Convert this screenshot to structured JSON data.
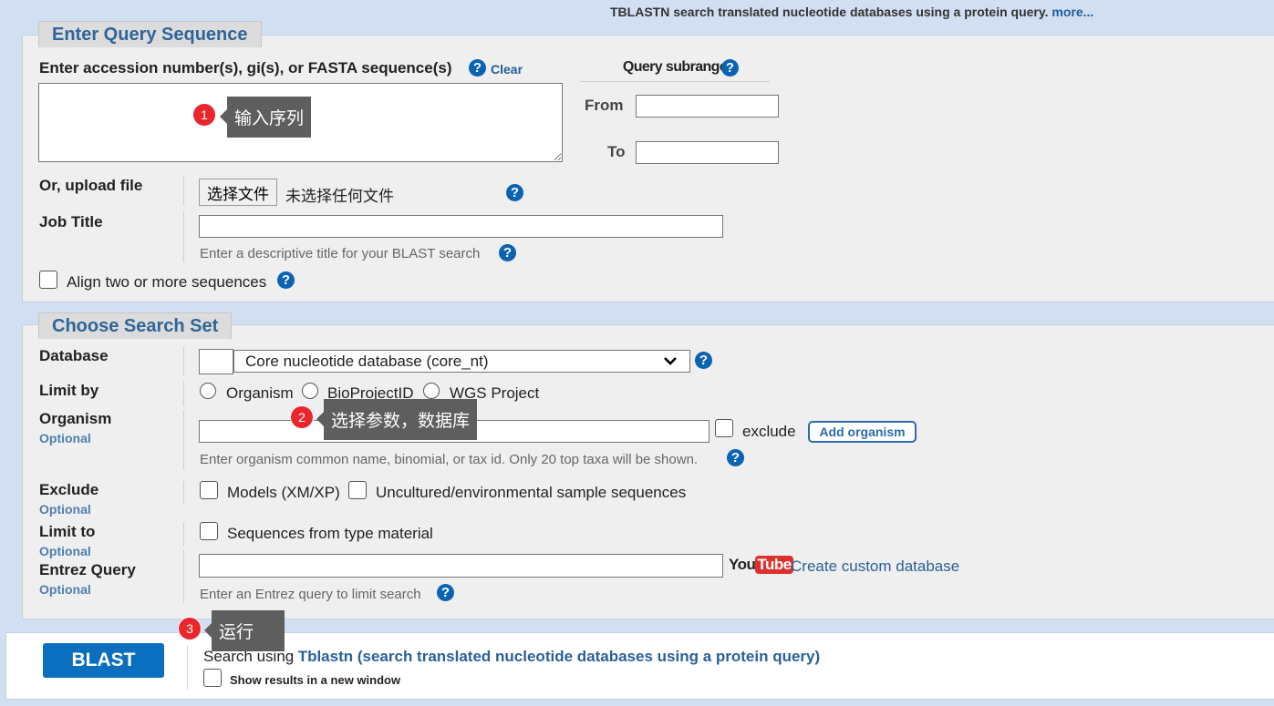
{
  "header": {
    "description": "TBLASTN search translated nucleotide databases using a protein query.",
    "more_link": "more..."
  },
  "query_section": {
    "legend": "Enter Query Sequence",
    "seq_label": "Enter accession number(s), gi(s), or FASTA sequence(s)",
    "clear_link": "Clear",
    "subrange_title": "Query subrange",
    "from_label": "From",
    "to_label": "To",
    "upload_label": "Or, upload file",
    "file_button": "选择文件",
    "file_status": "未选择任何文件",
    "job_title_label": "Job Title",
    "job_title_hint": "Enter a descriptive title for your BLAST search",
    "align_label": "Align two or more sequences"
  },
  "search_set": {
    "legend": "Choose Search Set",
    "database_label": "Database",
    "database_value": "Core nucleotide database (core_nt)",
    "limit_by_label": "Limit by",
    "limit_options": [
      "Organism",
      "BioProjectID",
      "WGS Project"
    ],
    "organism_label": "Organism",
    "optional": "Optional",
    "exclude_label": "exclude",
    "add_organism": "Add organism",
    "organism_hint": "Enter organism common name, binomial, or tax id. Only 20 top taxa will be shown.",
    "exclude_row_label": "Exclude",
    "models_label": "Models (XM/XP)",
    "uncultured_label": "Uncultured/environmental sample sequences",
    "limit_to_label": "Limit to",
    "type_material_label": "Sequences from type material",
    "entrez_label": "Entrez Query",
    "youtube_you": "You",
    "youtube_tube": "Tube",
    "custom_db_link": "Create custom database",
    "entrez_hint": "Enter an Entrez query to limit search"
  },
  "blast_bar": {
    "button": "BLAST",
    "search_using": "Search using",
    "program_link": "Tblastn (search translated nucleotide databases using a protein query)",
    "new_window_label": "Show results in a new window"
  },
  "annotations": [
    {
      "number": "1",
      "text": "输入序列"
    },
    {
      "number": "2",
      "text": "选择参数，数据库"
    },
    {
      "number": "3",
      "text": "运行"
    }
  ],
  "icons": {
    "help": "question-circle-icon",
    "dropdown": "chevron-down-icon"
  },
  "colors": {
    "accent": "#0b63b2",
    "legend_text": "#2f6599",
    "badge": "#e8262c",
    "tooltip": "#5e5e5e"
  }
}
